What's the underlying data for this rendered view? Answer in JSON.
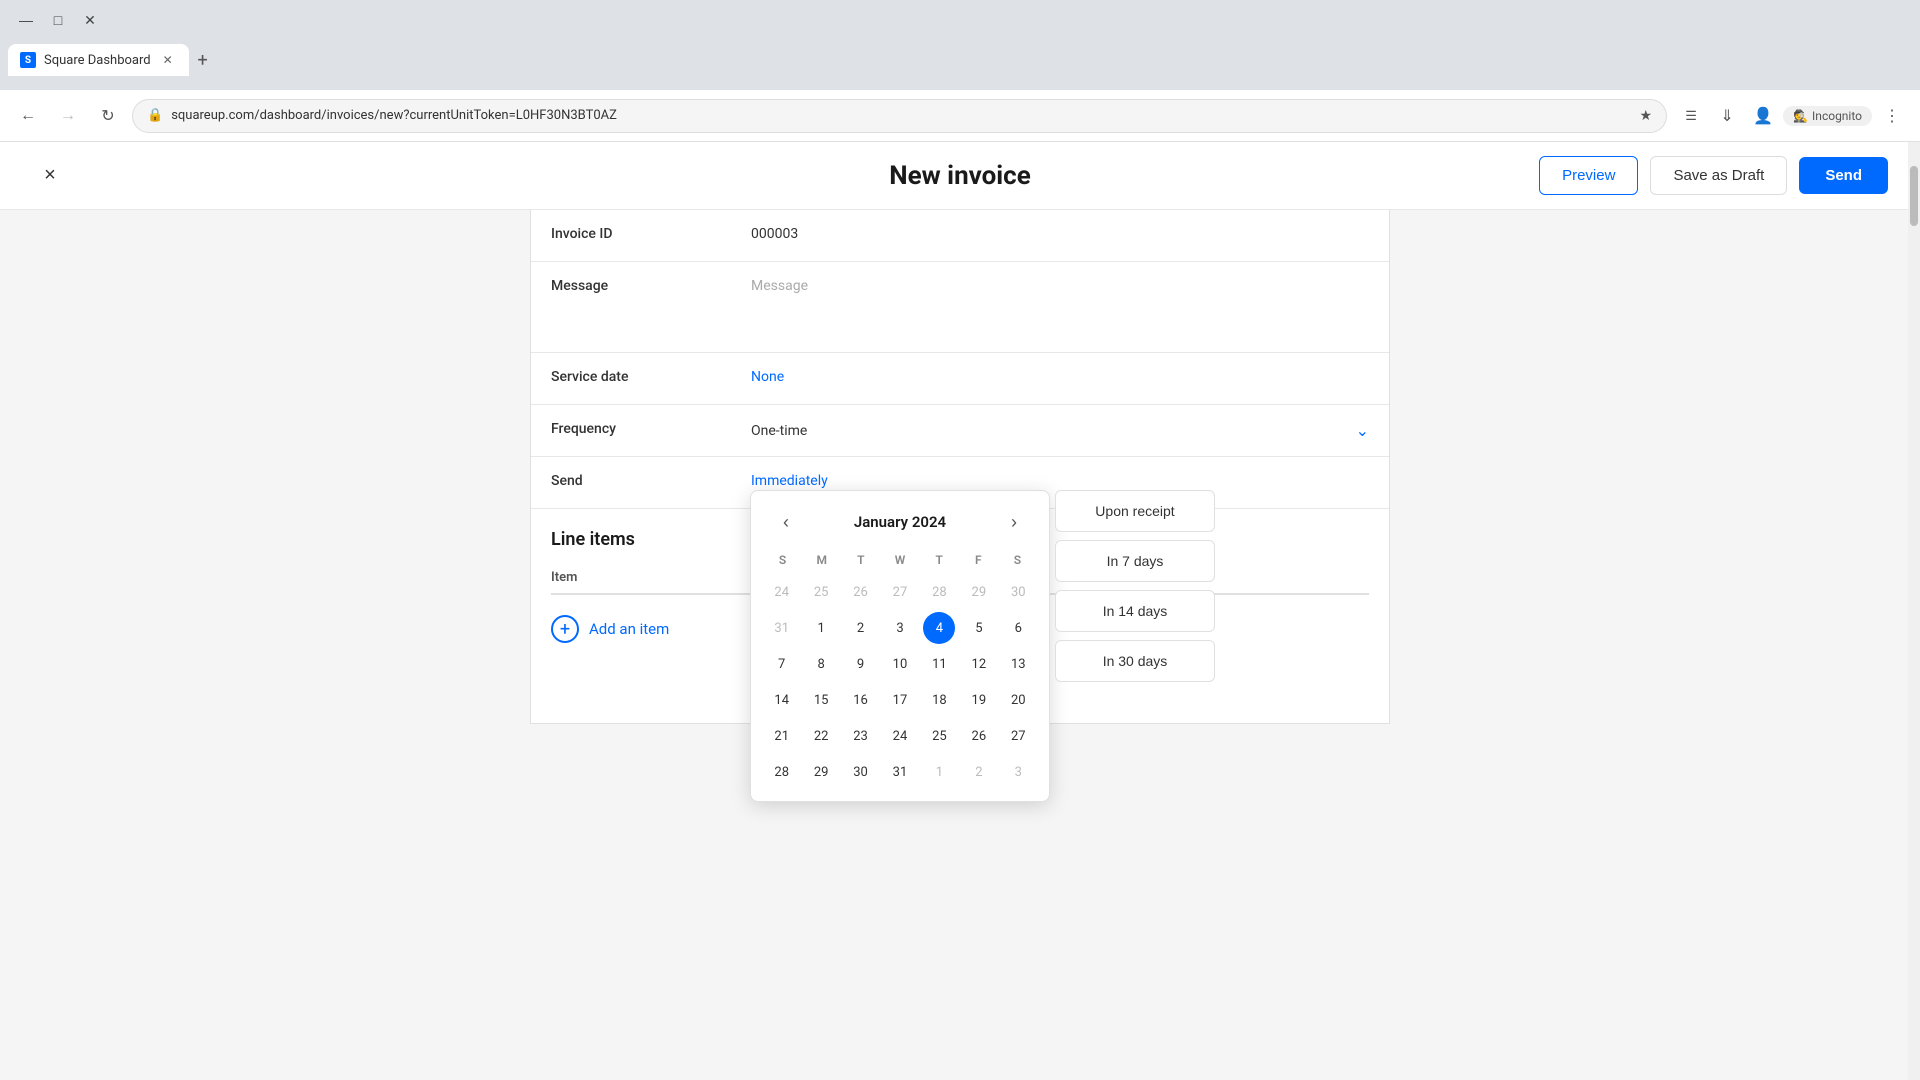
{
  "browser": {
    "back_disabled": false,
    "forward_disabled": true,
    "url": "squareup.com/dashboard/invoices/new?currentUnitToken=L0HF30N3BT0AZ",
    "tab_title": "Square Dashboard",
    "incognito_label": "Incognito",
    "new_tab_symbol": "+"
  },
  "header": {
    "title": "New invoice",
    "close_symbol": "×",
    "preview_label": "Preview",
    "save_draft_label": "Save as Draft",
    "send_label": "Send"
  },
  "form": {
    "invoice_id_label": "Invoice ID",
    "invoice_id_value": "000003",
    "message_label": "Message",
    "message_placeholder": "Message",
    "service_date_label": "Service date",
    "service_date_value": "None",
    "frequency_label": "Frequency",
    "frequency_value": "One-time",
    "send_label": "Send",
    "send_value": "Immediately"
  },
  "line_items": {
    "section_title": "Line items",
    "column_item": "Item",
    "add_item_label": "Add an item"
  },
  "calendar": {
    "month_title": "January 2024",
    "prev_symbol": "‹",
    "next_symbol": "›",
    "days_header": [
      "S",
      "M",
      "T",
      "W",
      "T",
      "F",
      "S"
    ],
    "weeks": [
      [
        "24",
        "25",
        "26",
        "27",
        "28",
        "29",
        "30"
      ],
      [
        "31",
        "1",
        "2",
        "3",
        "4",
        "5",
        "6"
      ],
      [
        "7",
        "8",
        "9",
        "10",
        "11",
        "12",
        "13"
      ],
      [
        "14",
        "15",
        "16",
        "17",
        "18",
        "19",
        "20"
      ],
      [
        "21",
        "22",
        "23",
        "24",
        "25",
        "26",
        "27"
      ],
      [
        "28",
        "29",
        "30",
        "31",
        "1",
        "2",
        "3"
      ]
    ],
    "weeks_other_month": [
      [
        true,
        true,
        true,
        true,
        true,
        true,
        true
      ],
      [
        true,
        false,
        false,
        false,
        false,
        false,
        false
      ],
      [
        false,
        false,
        false,
        false,
        false,
        false,
        false
      ],
      [
        false,
        false,
        false,
        false,
        false,
        false,
        false
      ],
      [
        false,
        false,
        false,
        false,
        false,
        false,
        false
      ],
      [
        false,
        false,
        false,
        false,
        false,
        true,
        true
      ]
    ],
    "selected_day": "4"
  },
  "due_options": {
    "upon_receipt": "Upon receipt",
    "in_7_days": "In 7 days",
    "in_14_days": "In 14 days",
    "in_30_days": "In 30 days"
  },
  "colors": {
    "blue": "#006aff",
    "text_primary": "#1a1a1a",
    "text_secondary": "#555",
    "border": "#e0e0e0"
  }
}
